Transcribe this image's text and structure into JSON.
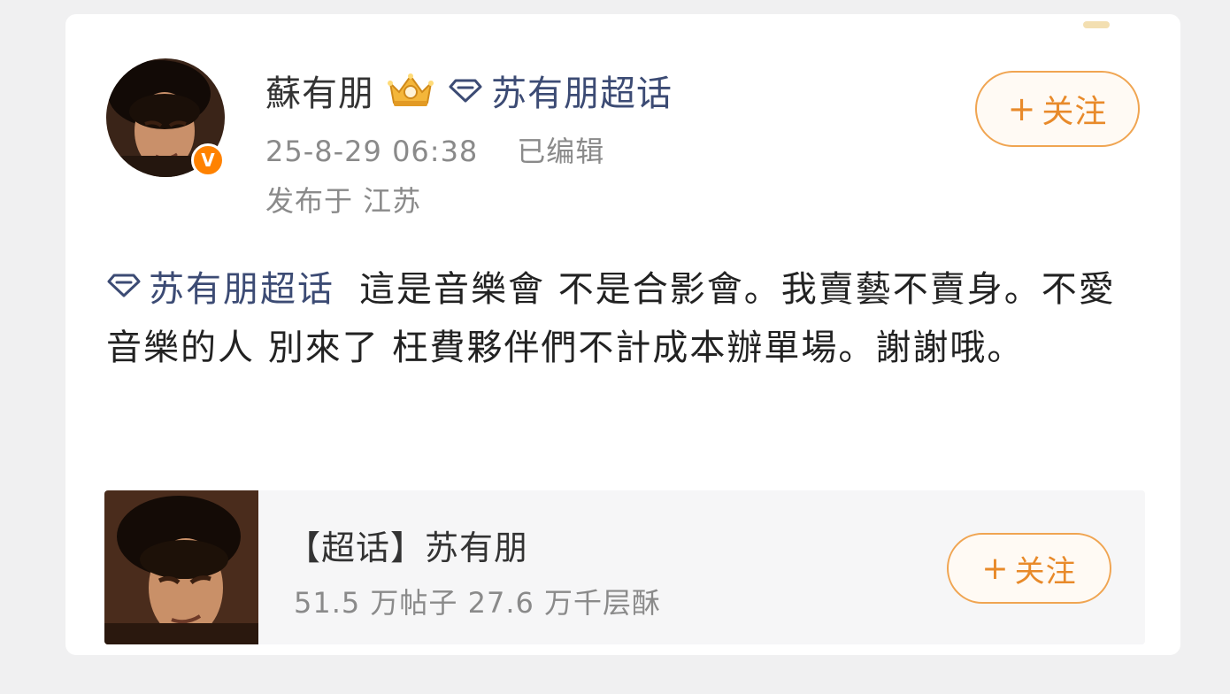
{
  "post": {
    "username": "蘇有朋",
    "topic_name": "苏有朋超话",
    "timestamp": "25-8-29 06:38",
    "edited_label": "已编辑",
    "location": "发布于 江苏",
    "follow_label": "关注",
    "content_topic": "苏有朋超话",
    "content_text": "這是音樂會 不是合影會。我賣藝不賣身。不愛音樂的人 別來了 枉費夥伴們不計成本辦單場。謝謝哦。"
  },
  "embed": {
    "title": "【超话】苏有朋",
    "stats": "51.5 万帖子 27.6 万千层酥",
    "follow_label": "关注"
  },
  "icons": {
    "crown": "crown-badge-icon",
    "topic": "diamond-topic-icon",
    "verified": "verified-v-icon",
    "plus": "plus-icon"
  },
  "colors": {
    "accent_orange": "#ff8200",
    "follow_text": "#e88a2a",
    "follow_border": "#f0a552",
    "topic_blue": "#3c4b74"
  }
}
